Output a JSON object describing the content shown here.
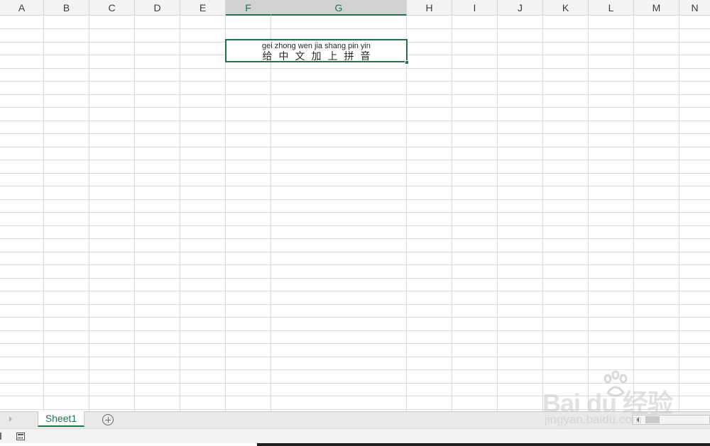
{
  "spreadsheet": {
    "columns": [
      "A",
      "B",
      "C",
      "D",
      "E",
      "F",
      "G",
      "H",
      "I",
      "J",
      "K",
      "L",
      "M",
      "N"
    ],
    "selected_columns": [
      "F",
      "G"
    ],
    "selected_cell": {
      "phonetic_text": "gei zhong wen jia shang pin yin",
      "text": "给中文加上拼音"
    }
  },
  "sheet_tabs": {
    "active_tab": "Sheet1"
  },
  "watermark": {
    "brand": "Bai du 经验",
    "url": "jingyan.baidu.com"
  },
  "colors": {
    "accent": "#217346",
    "gridline": "#dadada",
    "header_bg": "#f3f3f3",
    "selected_header_bg": "#d2d2d2"
  }
}
